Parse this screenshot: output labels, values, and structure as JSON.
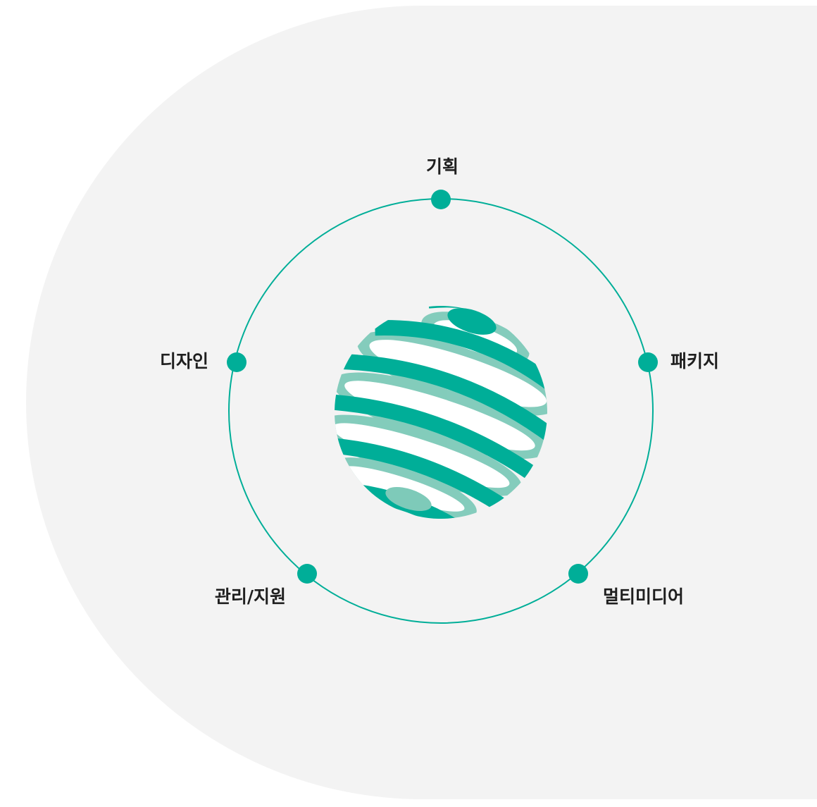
{
  "diagram": {
    "nodes": [
      {
        "id": "top",
        "label": "기획"
      },
      {
        "id": "right",
        "label": "패키지"
      },
      {
        "id": "bottom-right",
        "label": "멀티미디어"
      },
      {
        "id": "bottom-left",
        "label": "관리/지원"
      },
      {
        "id": "left",
        "label": "디자인"
      }
    ]
  },
  "colors": {
    "accent": "#00ae98",
    "accent_light": "#7ecab9",
    "background_shape": "#f3f3f3",
    "label_text": "#1f1f1f"
  },
  "icons": {
    "center": "striped-globe-icon"
  }
}
